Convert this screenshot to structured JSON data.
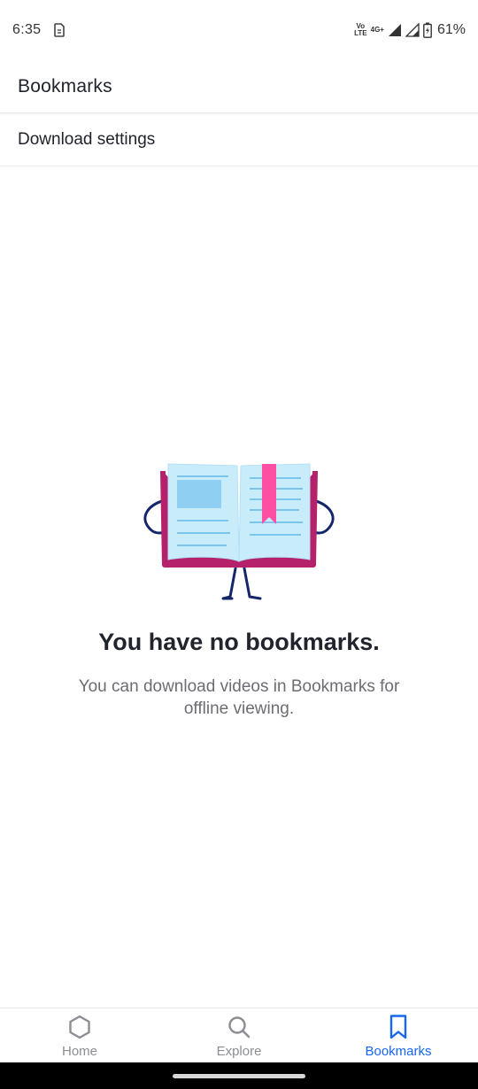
{
  "status_bar": {
    "time": "6:35",
    "network_top": "Vo",
    "network_bottom": "LTE",
    "signal_label": "4G+",
    "battery": "61%"
  },
  "header": {
    "title": "Bookmarks"
  },
  "settings_row": {
    "label": "Download settings"
  },
  "empty_state": {
    "title": "You have no bookmarks.",
    "body": "You can download videos in Bookmarks for offline viewing."
  },
  "bottom_nav": {
    "items": [
      {
        "label": "Home",
        "icon": "hexagon-icon",
        "active": false
      },
      {
        "label": "Explore",
        "icon": "search-icon",
        "active": false
      },
      {
        "label": "Bookmarks",
        "icon": "bookmark-icon",
        "active": true
      }
    ]
  },
  "colors": {
    "accent": "#1865f2",
    "text_primary": "#21242c",
    "text_secondary": "#6b6d72",
    "inactive": "#8c8e93",
    "book_cover": "#b5216b",
    "book_page": "#c9ecfb",
    "ribbon": "#ff4fa3"
  }
}
